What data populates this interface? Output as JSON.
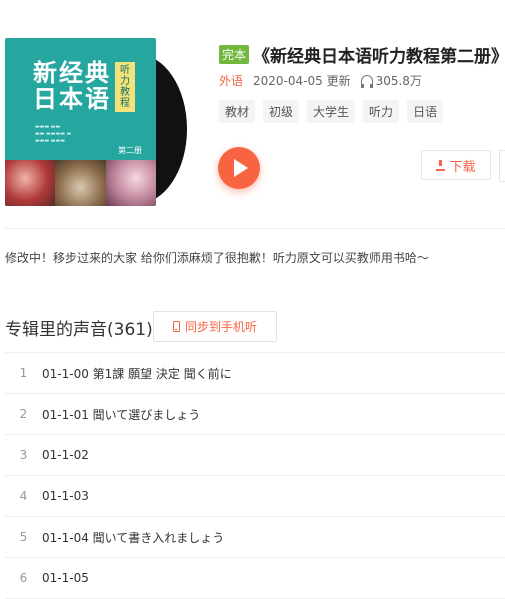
{
  "album": {
    "status_badge": "完本",
    "title": "《新经典日本语听力教程第二册》",
    "category": "外语",
    "date_updated": "2020-04-05 更新",
    "play_count": "305.8万",
    "tags": [
      "教材",
      "初级",
      "大学生",
      "听力",
      "日语"
    ],
    "cover": {
      "title_line1": "新经典",
      "title_line2": "日本语",
      "subtitle": "听力教程",
      "volume": "第二册"
    },
    "download_label": "下载",
    "intro": "修改中！移步过来的大家 给你们添麻烦了很抱歉！听力原文可以买教师用书哈～"
  },
  "tracks_section": {
    "heading": "专辑里的声音(361)",
    "sync_label": "同步到手机听",
    "tracks": [
      {
        "num": "1",
        "title": "01-1-00 第1課 願望 決定 聞く前に"
      },
      {
        "num": "2",
        "title": "01-1-01 聞いて選びましょう"
      },
      {
        "num": "3",
        "title": "01-1-02"
      },
      {
        "num": "4",
        "title": "01-1-03"
      },
      {
        "num": "5",
        "title": "01-1-04 聞いて書き入れましょう"
      },
      {
        "num": "6",
        "title": "01-1-05"
      }
    ]
  },
  "colors": {
    "accent": "#f86442",
    "badge_green": "#70b83e",
    "cover_teal": "#25a7a0"
  }
}
